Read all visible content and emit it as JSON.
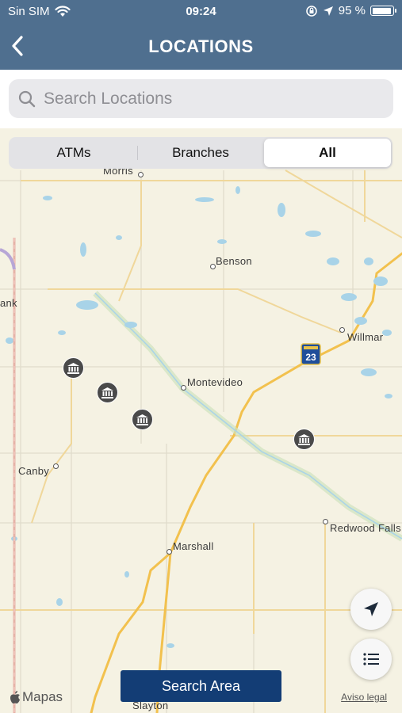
{
  "status_bar": {
    "carrier": "Sin SIM",
    "time": "09:24",
    "battery_percent": "95 %",
    "battery_level": 0.95
  },
  "header": {
    "title": "LOCATIONS",
    "back_icon": "chevron-left-icon"
  },
  "search": {
    "placeholder": "Search Locations",
    "value": ""
  },
  "filter_tabs": [
    {
      "label": "ATMs",
      "selected": false
    },
    {
      "label": "Branches",
      "selected": false
    },
    {
      "label": "All",
      "selected": true
    }
  ],
  "map": {
    "towns": [
      "Morris",
      "Benson",
      "Willmar",
      "Montevideo",
      "Canby",
      "Redwood Falls",
      "Marshall",
      "Slayton",
      "ank"
    ],
    "highway_shield": "23",
    "branch_pin_icon": "bank-icon",
    "branch_pin_count": 4,
    "attribution": "Mapas",
    "legal_link": "Aviso legal"
  },
  "actions": {
    "locate_icon": "location-arrow-icon",
    "list_icon": "list-icon",
    "search_area_label": "Search Area"
  },
  "colors": {
    "header_bg": "#4f6f8f",
    "search_button_bg": "#133d75",
    "map_land": "#f5f2e3",
    "pin_bg": "#4a4a4a"
  }
}
